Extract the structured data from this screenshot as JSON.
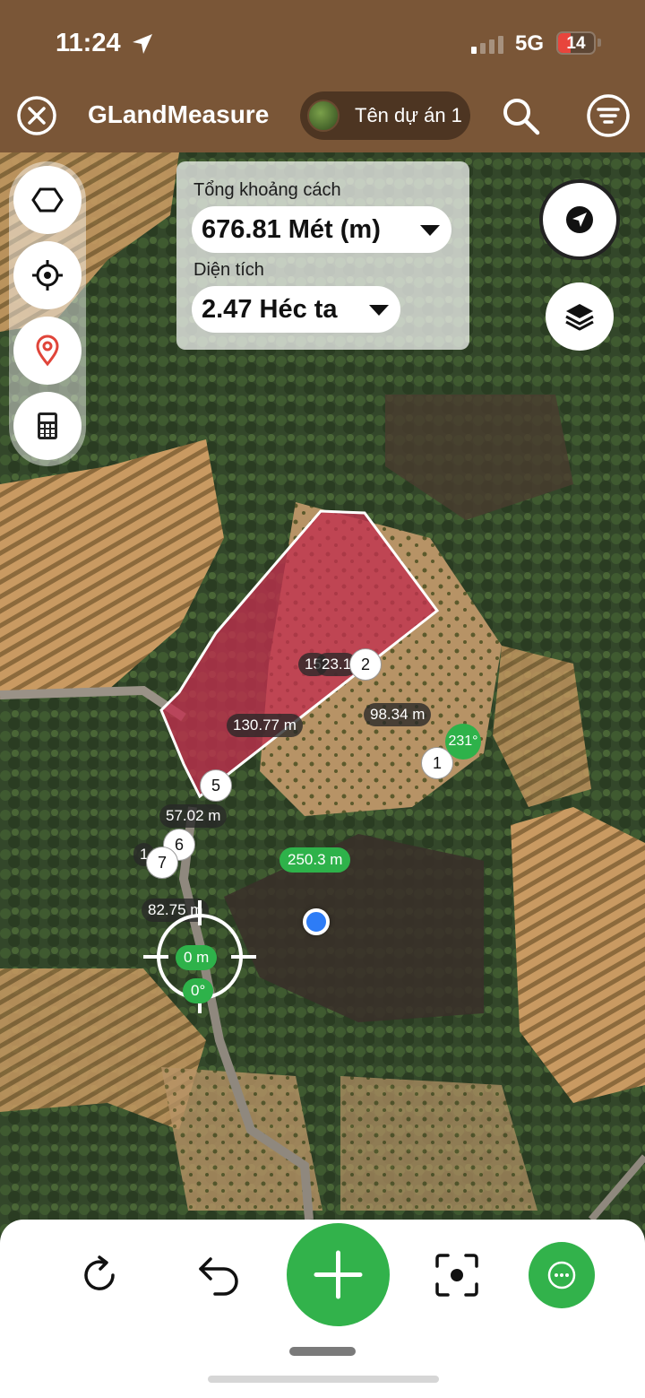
{
  "status_bar": {
    "time": "11:24",
    "network": "5G",
    "battery": "14",
    "icons": [
      "location-arrow-icon",
      "signal-bars-icon",
      "battery-icon"
    ]
  },
  "header": {
    "app_title": "GLandMeasure",
    "project_name": "Tên dự án 1",
    "icons": [
      "close-icon",
      "search-icon",
      "menu-icon"
    ]
  },
  "measurement": {
    "distance_label": "Tổng khoảng cách",
    "distance_value": "676.81 Mét (m)",
    "area_label": "Diện tích",
    "area_value": "2.47 Héc ta"
  },
  "left_tools": [
    "polygon-icon",
    "crosshair-icon",
    "location-pin-icon",
    "calculator-icon"
  ],
  "right_tools": [
    "navigation-icon",
    "layers-icon"
  ],
  "map": {
    "vertices": [
      "1",
      "2",
      "5",
      "6",
      "7"
    ],
    "segment_labels": {
      "top_edge": "130.77 m",
      "right_edge": "98.34 m",
      "bottom_edge": "250.3 m",
      "left_upper": "57.02 m",
      "left_lower": "82.75 m",
      "top_partial_a": "15",
      "top_partial_b": "23.1",
      "left_partial": "1"
    },
    "angle": "231°",
    "cursor_distance": "0 m",
    "cursor_angle": "0°",
    "colors": {
      "polygon_fill": "#c2304e",
      "polygon_stroke": "#ffffff",
      "accent_green": "#32b24b",
      "header_brown": "#7a5637"
    }
  },
  "bottom_bar": {
    "icons": [
      "redo-icon",
      "undo-icon",
      "add-icon",
      "focus-icon",
      "more-icon"
    ]
  }
}
